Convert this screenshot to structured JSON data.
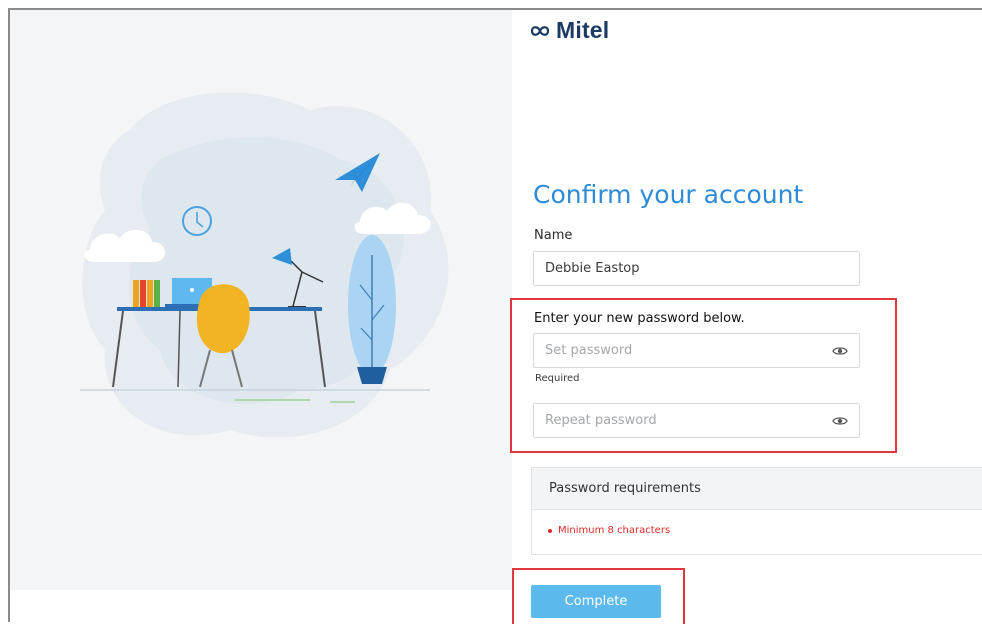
{
  "brand": {
    "logo_text": "Mitel"
  },
  "form": {
    "title": "Confirm your account",
    "name_label": "Name",
    "name_value": "Debbie Eastop",
    "password_prompt": "Enter your new password below.",
    "set_password_placeholder": "Set password",
    "required_text": "Required",
    "repeat_password_placeholder": "Repeat password"
  },
  "requirements": {
    "heading": "Password requirements",
    "items": [
      "Minimum 8 characters"
    ]
  },
  "actions": {
    "complete_label": "Complete"
  },
  "colors": {
    "accent": "#2e8bd6",
    "button": "#5cb9ec",
    "error": "#e02a2a",
    "highlight_box": "#e0363e",
    "logo": "#1b3a64"
  },
  "icons": [
    "mitel-logo-icon",
    "eye-icon"
  ]
}
